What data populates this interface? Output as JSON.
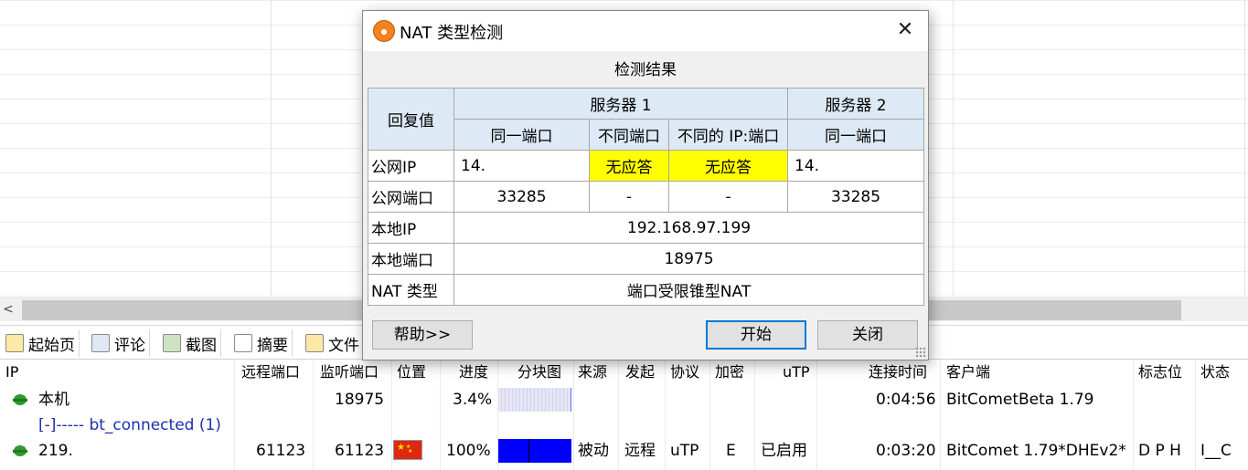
{
  "dialog": {
    "title": "NAT 类型检测",
    "close_symbol": "✕",
    "section_title": "检测结果",
    "table": {
      "reply_header": "回复值",
      "server1": "服务器 1",
      "server2": "服务器 2",
      "col_same_port_1": "同一端口",
      "col_diff_port": "不同端口",
      "col_diff_ip_port": "不同的 IP:端口",
      "col_same_port_2": "同一端口",
      "rows": {
        "public_ip_label": "公网IP",
        "public_ip_s1_same": "14.",
        "public_ip_s1_diff_port": "无应答",
        "public_ip_s1_diff_ip": "无应答",
        "public_ip_s2_same": "14.",
        "public_port_label": "公网端口",
        "public_port_s1_same": "33285",
        "public_port_s1_diff_port": "-",
        "public_port_s1_diff_ip": "-",
        "public_port_s2_same": "33285",
        "local_ip_label": "本地IP",
        "local_ip_value": "192.168.97.199",
        "local_port_label": "本地端口",
        "local_port_value": "18975",
        "nat_type_label": "NAT 类型",
        "nat_type_value": "端口受限锥型NAT"
      }
    },
    "buttons": {
      "help": "帮助>>",
      "start": "开始",
      "close": "关闭"
    },
    "highlight_color": "#ffff00",
    "header_color": "#dde9f4"
  },
  "tabs": [
    {
      "label": "起始页",
      "icon": "home-page-icon"
    },
    {
      "label": "评论",
      "icon": "comment-icon"
    },
    {
      "label": "截图",
      "icon": "screenshot-icon"
    },
    {
      "label": "摘要",
      "icon": "summary-icon"
    },
    {
      "label": "文件",
      "icon": "file-icon"
    }
  ],
  "peer_list": {
    "columns": [
      "IP",
      "远程端口",
      "监听端口",
      "位置",
      "进度",
      "分块图",
      "来源",
      "发起",
      "协议",
      "加密",
      "uTP",
      "连接时间",
      "客户端",
      "标志位",
      "状态"
    ],
    "rows": [
      {
        "ip": "本机",
        "remote_port": "",
        "listen_port": "18975",
        "progress": "3.4%",
        "progress_value": 3.4,
        "source": "",
        "initiator": "",
        "protocol": "",
        "encryption": "",
        "utp": "",
        "conn_time": "0:04:56",
        "client": "BitCometBeta 1.79",
        "flags": "",
        "status": ""
      },
      {
        "group": "[-]----- bt_connected (1)"
      },
      {
        "ip": "219.",
        "remote_port": "61123",
        "listen_port": "61123",
        "progress": "100%",
        "progress_value": 100,
        "source": "被动",
        "initiator": "远程",
        "protocol": "uTP",
        "encryption": "E",
        "utp": "已启用",
        "conn_time": "0:03:20",
        "client": "BitComet 1.79*DHEv2*",
        "flags": "D P H",
        "status": "I__C"
      }
    ]
  }
}
